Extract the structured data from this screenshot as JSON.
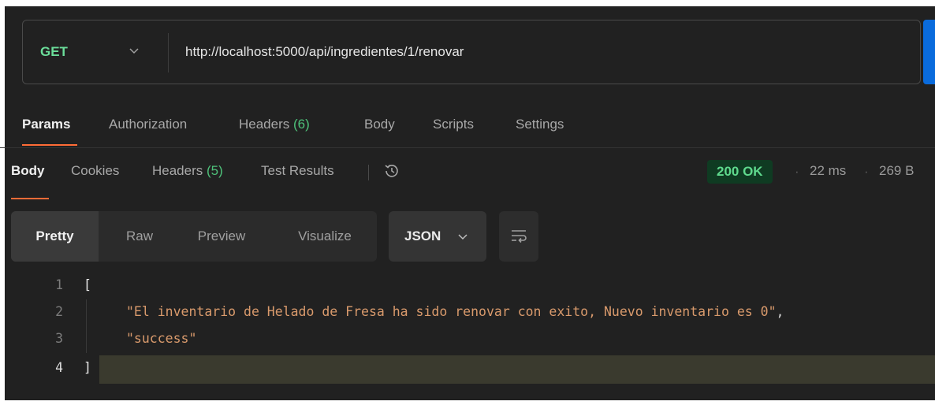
{
  "request": {
    "method": "GET",
    "url": "http://localhost:5000/api/ingredientes/1/renovar"
  },
  "request_tabs": {
    "params": "Params",
    "authorization": "Authorization",
    "headers": "Headers",
    "headers_count": "(6)",
    "body": "Body",
    "scripts": "Scripts",
    "settings": "Settings"
  },
  "response_tabs": {
    "body": "Body",
    "cookies": "Cookies",
    "headers": "Headers",
    "headers_count": "(5)",
    "test_results": "Test Results"
  },
  "response_meta": {
    "status": "200 OK",
    "time": "22 ms",
    "size": "269 B"
  },
  "view_modes": {
    "pretty": "Pretty",
    "raw": "Raw",
    "preview": "Preview",
    "visualize": "Visualize",
    "format": "JSON"
  },
  "code": {
    "line_numbers": [
      "1",
      "2",
      "3",
      "4"
    ],
    "open_bracket": "[",
    "close_bracket": "]",
    "line2": "\"El inventario de Helado de Fresa ha sido renovar con exito, Nuevo inventario es 0\"",
    "line2_comma": ",",
    "line3": "\"success\""
  },
  "colors": {
    "accent": "#ff6c37",
    "method_get": "#6bdd9a",
    "status_ok": "#5fd98d",
    "string": "#d99a6c"
  },
  "icons": [
    "chevron-down-icon",
    "history-icon",
    "wrap-lines-icon"
  ]
}
